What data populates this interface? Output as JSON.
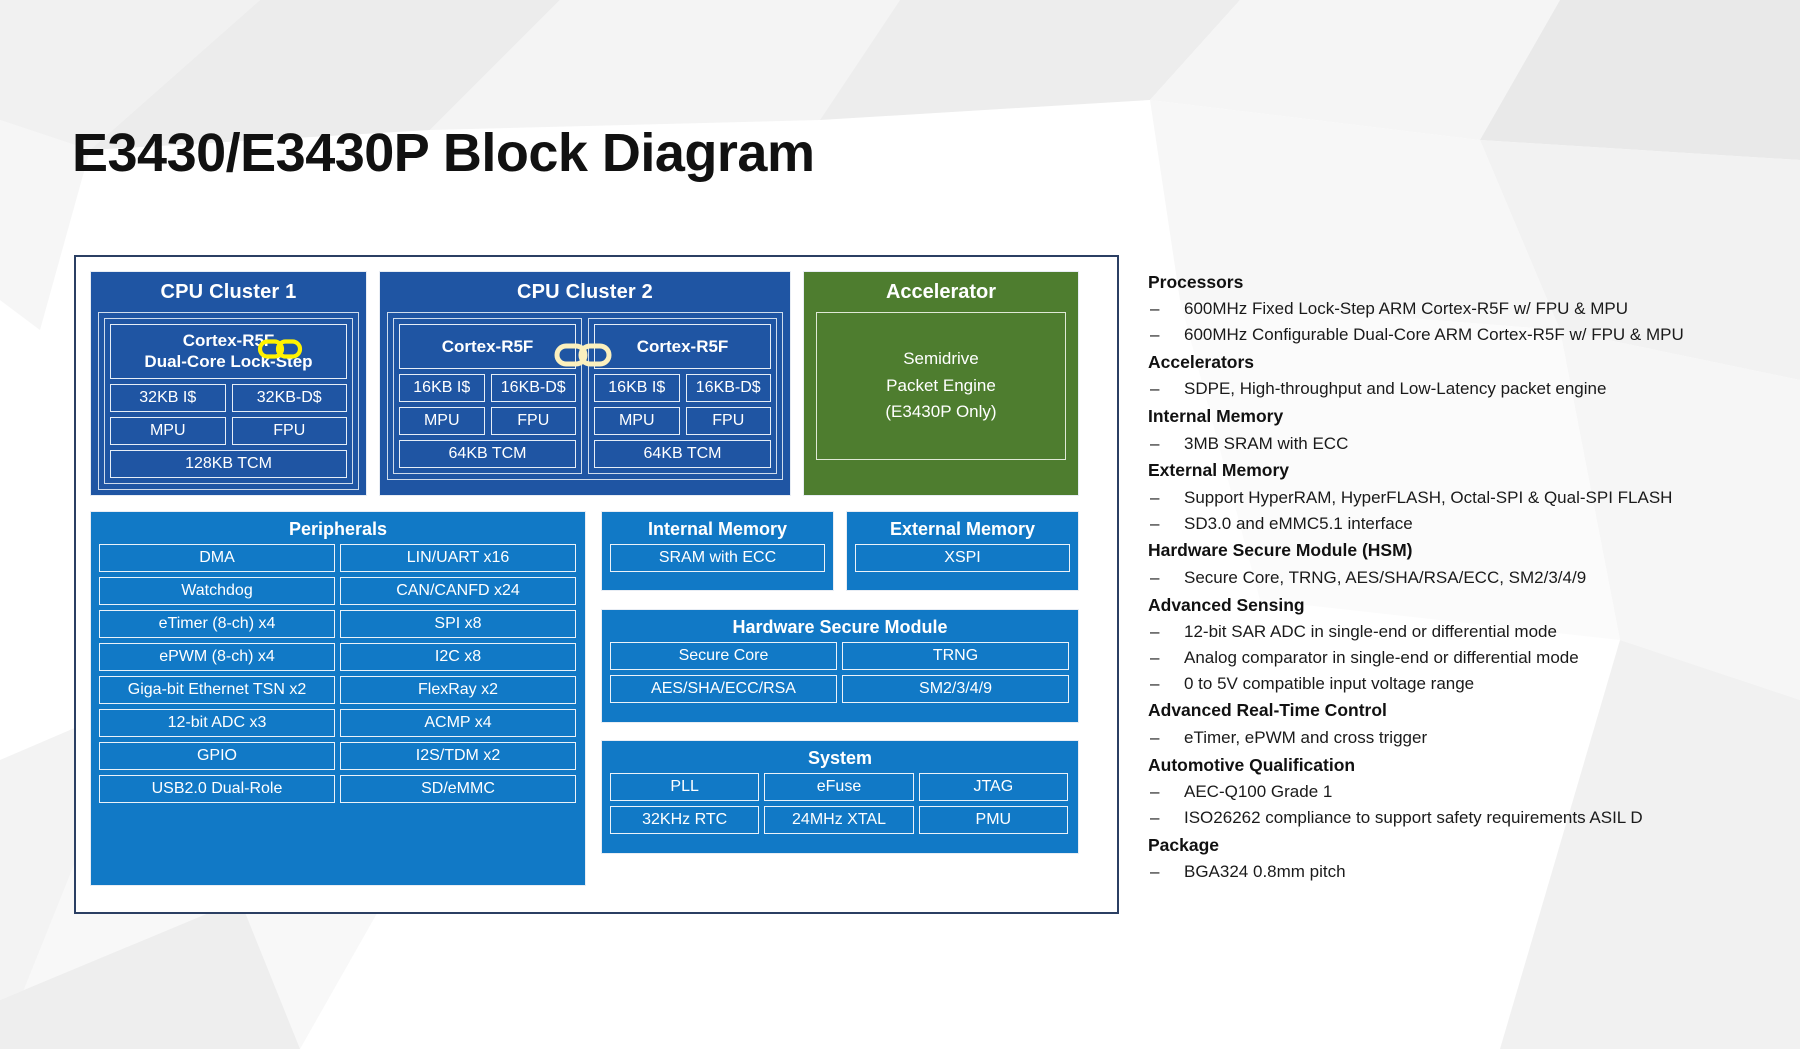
{
  "page_title": "E3430/E3430P Block Diagram",
  "colors": {
    "cluster_blue": "#1F55A3",
    "light_blue": "#1179C6",
    "accelerator_green": "#4E7D2F",
    "frame_border": "#2B3F63",
    "link_icon_bright": "#FFF200",
    "link_icon_pale": "#FBF0BE"
  },
  "diagram": {
    "cpu_cluster_1": {
      "title": "CPU Cluster 1",
      "core_name_line1": "Cortex-R5F",
      "core_name_line2": "Dual-Core Lock-Step",
      "link_icon": "chain-link-icon",
      "cells": [
        "32KB I$",
        "32KB-D$",
        "MPU",
        "FPU"
      ],
      "tcm": "128KB TCM"
    },
    "cpu_cluster_2": {
      "title": "CPU Cluster 2",
      "link_icon": "chain-link-icon",
      "core_a": {
        "name": "Cortex-R5F",
        "cells": [
          "16KB I$",
          "16KB-D$",
          "MPU",
          "FPU"
        ],
        "tcm": "64KB TCM"
      },
      "core_b": {
        "name": "Cortex-R5F",
        "cells": [
          "16KB I$",
          "16KB-D$",
          "MPU",
          "FPU"
        ],
        "tcm": "64KB TCM"
      }
    },
    "accelerator": {
      "title": "Accelerator",
      "body_line1": "Semidrive",
      "body_line2": "Packet Engine",
      "body_line3": "(E3430P Only)"
    },
    "peripherals": {
      "title": "Peripherals",
      "items": [
        "DMA",
        "LIN/UART x16",
        "Watchdog",
        "CAN/CANFD x24",
        "eTimer (8-ch) x4",
        "SPI x8",
        "ePWM (8-ch) x4",
        "I2C x8",
        "Giga-bit Ethernet TSN x2",
        "FlexRay x2",
        "12-bit ADC x3",
        "ACMP x4",
        "GPIO",
        "I2S/TDM x2",
        "USB2.0 Dual-Role",
        "SD/eMMC"
      ]
    },
    "internal_memory": {
      "title": "Internal Memory",
      "items": [
        "SRAM with ECC"
      ]
    },
    "external_memory": {
      "title": "External Memory",
      "items": [
        "XSPI"
      ]
    },
    "hardware_secure_module": {
      "title": "Hardware Secure Module",
      "items": [
        "Secure Core",
        "TRNG",
        "AES/SHA/ECC/RSA",
        "SM2/3/4/9"
      ]
    },
    "system": {
      "title": "System",
      "items": [
        "PLL",
        "eFuse",
        "JTAG",
        "32KHz RTC",
        "24MHz XTAL",
        "PMU"
      ]
    }
  },
  "features": [
    {
      "heading": "Processors",
      "items": [
        "600MHz Fixed Lock-Step ARM Cortex-R5F w/ FPU & MPU",
        "600MHz Configurable Dual-Core ARM Cortex-R5F w/ FPU & MPU"
      ]
    },
    {
      "heading": "Accelerators",
      "items": [
        "SDPE, High-throughput and Low-Latency packet engine"
      ]
    },
    {
      "heading": "Internal Memory",
      "items": [
        "3MB SRAM with ECC"
      ]
    },
    {
      "heading": "External Memory",
      "items": [
        "Support HyperRAM, HyperFLASH, Octal-SPI & Qual-SPI FLASH",
        "SD3.0 and eMMC5.1 interface"
      ]
    },
    {
      "heading": "Hardware Secure Module (HSM)",
      "items": [
        "Secure Core, TRNG, AES/SHA/RSA/ECC, SM2/3/4/9"
      ]
    },
    {
      "heading": "Advanced Sensing",
      "items": [
        "12-bit SAR ADC in single-end or differential mode",
        "Analog comparator in single-end or differential mode",
        "0 to 5V compatible input voltage range"
      ]
    },
    {
      "heading": "Advanced Real-Time Control",
      "items": [
        "eTimer, ePWM and cross trigger"
      ]
    },
    {
      "heading": "Automotive Qualification",
      "items": [
        "AEC-Q100 Grade 1",
        "ISO26262 compliance to support safety requirements ASIL D"
      ]
    },
    {
      "heading": "Package",
      "items": [
        "BGA324 0.8mm pitch"
      ]
    }
  ],
  "bullet_dash": "–"
}
